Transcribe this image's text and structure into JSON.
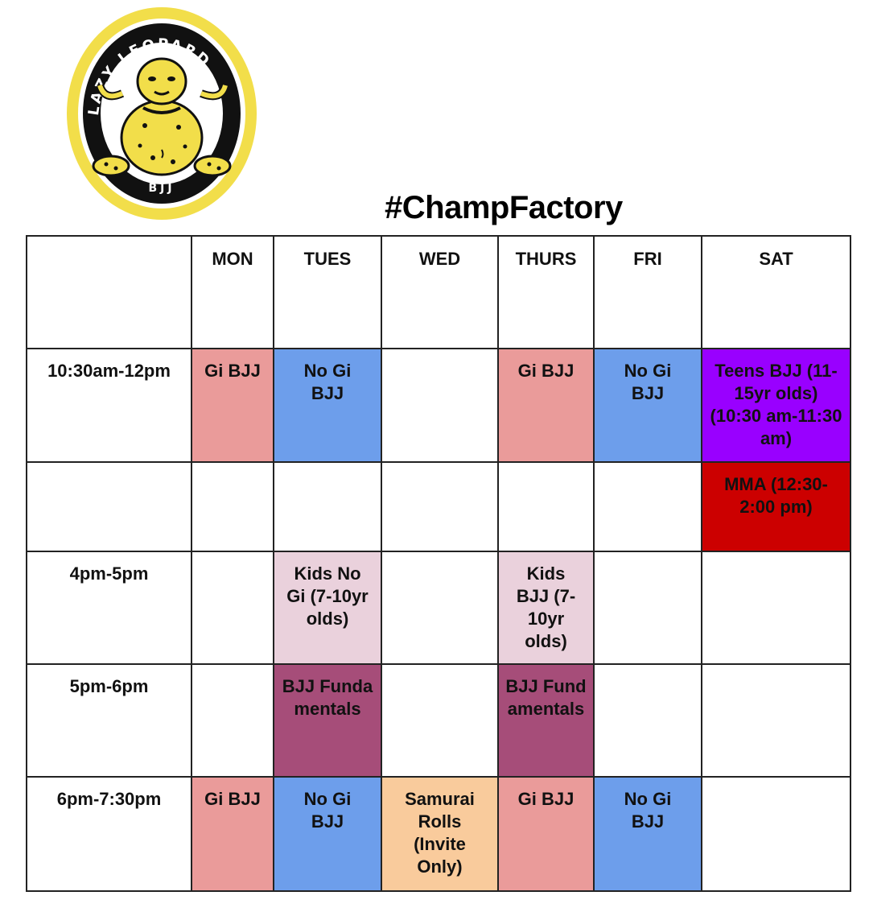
{
  "logo": {
    "top_text": "LAZY LEOPARD",
    "bottom_text": "BJJ"
  },
  "title": "#ChampFactory",
  "days": [
    "MON",
    "TUES",
    "WED",
    "THURS",
    "FRI",
    "SAT"
  ],
  "rows": [
    {
      "time": "10:30am-12pm",
      "cells": [
        "Gi BJJ",
        "No Gi BJJ",
        "",
        "Gi BJJ",
        "No Gi BJJ",
        "Teens BJJ (11-15yr olds) (10:30 am-11:30 am)"
      ]
    },
    {
      "time": "",
      "cells": [
        "",
        "",
        "",
        "",
        "",
        "MMA (12:30-2:00 pm)"
      ]
    },
    {
      "time": "4pm-5pm",
      "cells": [
        "",
        "Kids No Gi (7-10yr olds)",
        "",
        "Kids BJJ (7-10yr olds)",
        "",
        ""
      ]
    },
    {
      "time": "5pm-6pm",
      "cells": [
        "",
        "BJJ Fundamentals",
        "",
        "BJJ Fundamentals",
        "",
        ""
      ]
    },
    {
      "time": "6pm-7:30pm",
      "cells": [
        "Gi BJJ",
        "No Gi BJJ",
        "Samurai Rolls (Invite Only)",
        "Gi BJJ",
        "No Gi BJJ",
        ""
      ]
    }
  ],
  "colors": {
    "gi_bjj": "#ea9b9a",
    "no_gi_bjj": "#6d9eeb",
    "kids": "#ead1dc",
    "fundamentals": "#a64d79",
    "samurai": "#f9cb9c",
    "teens": "#9900ff",
    "mma": "#cc0000",
    "logo_yellow": "#f2de4a"
  }
}
